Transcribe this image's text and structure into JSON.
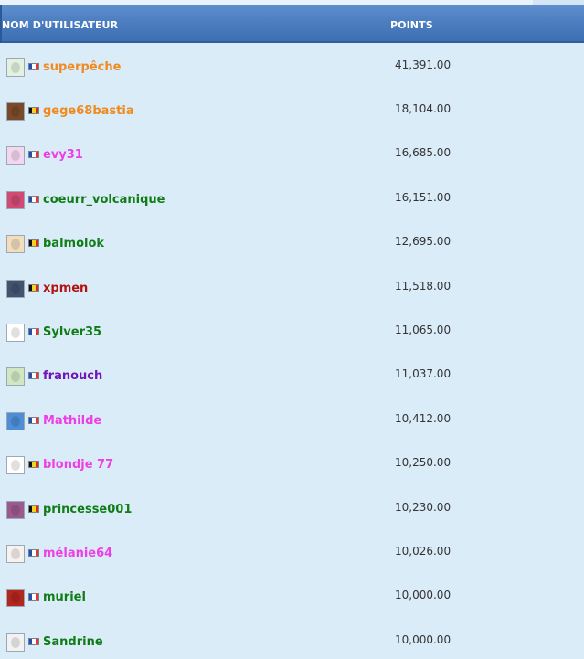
{
  "table": {
    "columns": {
      "user_header": "NOM D'UTILISATEUR",
      "points_header": "POINTS"
    },
    "colors": {
      "header_bg": "#4c7ec0",
      "row_bg": "#dbecf9",
      "points_text": "#333333"
    },
    "rows": [
      {
        "username": "superpêche",
        "points": "41,391.00",
        "country": "France",
        "flag_colors": [
          "#1f4fb8",
          "#ffffff",
          "#e3342f"
        ],
        "name_color": "#f08a1f",
        "avatar_icon": "frog-avatar-icon",
        "avatar_bg": "#e2f2df"
      },
      {
        "username": "gege68bastia",
        "points": "18,104.00",
        "country": "Belgium",
        "flag_colors": [
          "#111111",
          "#f2d21a",
          "#d92626"
        ],
        "name_color": "#f08a1f",
        "avatar_icon": "portrait-avatar-icon",
        "avatar_bg": "#7a4b2a"
      },
      {
        "username": "evy31",
        "points": "16,685.00",
        "country": "France",
        "flag_colors": [
          "#1f4fb8",
          "#ffffff",
          "#e3342f"
        ],
        "name_color": "#ee3fe6",
        "avatar_icon": "framed-picture-avatar-icon",
        "avatar_bg": "#f3d7ef"
      },
      {
        "username": "coeurr_volcanique",
        "points": "16,151.00",
        "country": "France",
        "flag_colors": [
          "#1f4fb8",
          "#ffffff",
          "#e3342f"
        ],
        "name_color": "#0f7c16",
        "avatar_icon": "heart-avatar-icon",
        "avatar_bg": "#d14a74"
      },
      {
        "username": "balmolok",
        "points": "12,695.00",
        "country": "Belgium",
        "flag_colors": [
          "#111111",
          "#f2d21a",
          "#d92626"
        ],
        "name_color": "#0f7c16",
        "avatar_icon": "face-avatar-icon",
        "avatar_bg": "#f2ddbd"
      },
      {
        "username": "xpmen",
        "points": "11,518.00",
        "country": "Belgium",
        "flag_colors": [
          "#111111",
          "#f2d21a",
          "#d92626"
        ],
        "name_color": "#b21212",
        "avatar_icon": "computer-avatar-icon",
        "avatar_bg": "#40546f"
      },
      {
        "username": "Sylver35",
        "points": "11,065.00",
        "country": "France",
        "flag_colors": [
          "#1f4fb8",
          "#ffffff",
          "#e3342f"
        ],
        "name_color": "#0f7c16",
        "avatar_icon": "eyes-avatar-icon",
        "avatar_bg": "#ffffff"
      },
      {
        "username": "franouch",
        "points": "11,037.00",
        "country": "France",
        "flag_colors": [
          "#1f4fb8",
          "#ffffff",
          "#e3342f"
        ],
        "name_color": "#6f16b8",
        "avatar_icon": "dragon-avatar-icon",
        "avatar_bg": "#cfe8c3"
      },
      {
        "username": "Mathilde",
        "points": "10,412.00",
        "country": "France",
        "flag_colors": [
          "#1f4fb8",
          "#ffffff",
          "#e3342f"
        ],
        "name_color": "#ee3fe6",
        "avatar_icon": "dancer-avatar-icon",
        "avatar_bg": "#4d8ed6"
      },
      {
        "username": "blondje 77",
        "points": "10,250.00",
        "country": "Belgium",
        "flag_colors": [
          "#111111",
          "#f2d21a",
          "#d92626"
        ],
        "name_color": "#ee3fe6",
        "avatar_icon": "cartoon-avatar-icon",
        "avatar_bg": "#ffffff"
      },
      {
        "username": "princesse001",
        "points": "10,230.00",
        "country": "Belgium",
        "flag_colors": [
          "#111111",
          "#f2d21a",
          "#d92626"
        ],
        "name_color": "#0f7c16",
        "avatar_icon": "princess-avatar-icon",
        "avatar_bg": "#9b5a8f"
      },
      {
        "username": "mélanie64",
        "points": "10,026.00",
        "country": "France",
        "flag_colors": [
          "#1f4fb8",
          "#ffffff",
          "#e3342f"
        ],
        "name_color": "#ee3fe6",
        "avatar_icon": "doll-avatar-icon",
        "avatar_bg": "#f7f2ef"
      },
      {
        "username": "muriel",
        "points": "10,000.00",
        "country": "France",
        "flag_colors": [
          "#1f4fb8",
          "#ffffff",
          "#e3342f"
        ],
        "name_color": "#0f7c16",
        "avatar_icon": "fire-avatar-icon",
        "avatar_bg": "#b3261e"
      },
      {
        "username": "Sandrine",
        "points": "10,000.00",
        "country": "France",
        "flag_colors": [
          "#1f4fb8",
          "#ffffff",
          "#e3342f"
        ],
        "name_color": "#0f7c16",
        "avatar_icon": "sketch-avatar-icon",
        "avatar_bg": "#f2f2f2"
      }
    ]
  }
}
